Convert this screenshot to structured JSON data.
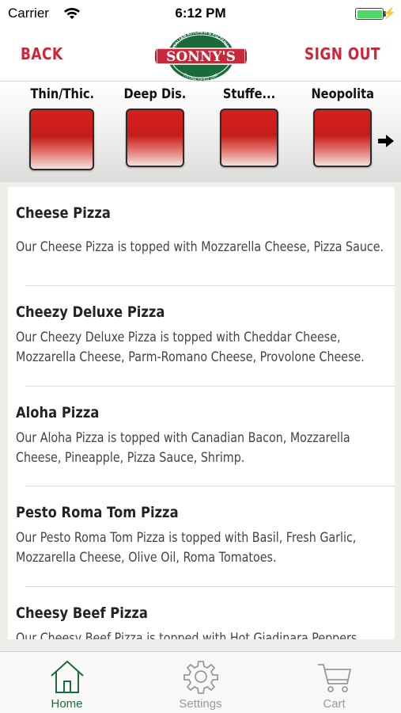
{
  "status_bar": {
    "carrier": "Carrier",
    "time": "6:12 PM",
    "battery_level": 1.0
  },
  "header": {
    "back_label": "BACK",
    "signout_label": "SIGN OUT",
    "logo_text": "SONNY'S",
    "logo_ring_top": "ITALIAN KITCHEN & PIZZERIA",
    "logo_ring_bottom": "ESTABLISHED 1986"
  },
  "categories": [
    {
      "label": "Thin/Thic..."
    },
    {
      "label": "Deep Dis..."
    },
    {
      "label": "Stuffe..."
    },
    {
      "label": "Neopolitan"
    }
  ],
  "menu_items": [
    {
      "name": "Cheese Pizza",
      "description": "Our Cheese Pizza is topped with Mozzarella Cheese, Pizza Sauce."
    },
    {
      "name": "Cheezy Deluxe Pizza",
      "description": "Our Cheezy Deluxe Pizza is topped with Cheddar Cheese, Mozzarella Cheese, Parm-Romano Cheese, Provolone Cheese."
    },
    {
      "name": " Aloha Pizza",
      "description": "Our  Aloha Pizza is topped with Canadian Bacon, Mozzarella Cheese, Pineapple, Pizza Sauce, Shrimp."
    },
    {
      "name": "Pesto Roma Tom Pizza",
      "description": "Our Pesto Roma Tom Pizza is topped with Basil, Fresh Garlic, Mozzarella Cheese, Olive Oil, Roma Tomatoes."
    },
    {
      "name": "Cheesy Beef Pizza",
      "description": "Our Cheesy Beef Pizza is topped with Hot Giadinara Peppers"
    }
  ],
  "tabs": [
    {
      "label": "Home",
      "icon": "home-icon",
      "active": true
    },
    {
      "label": "Settings",
      "icon": "gear-icon",
      "active": false
    },
    {
      "label": "Cart",
      "icon": "cart-icon",
      "active": false
    }
  ],
  "colors": {
    "accent_red": "#c8283a",
    "logo_green": "#1b6b3a",
    "tab_active": "#1c6b3c",
    "tab_inactive": "#9a9a9a"
  }
}
